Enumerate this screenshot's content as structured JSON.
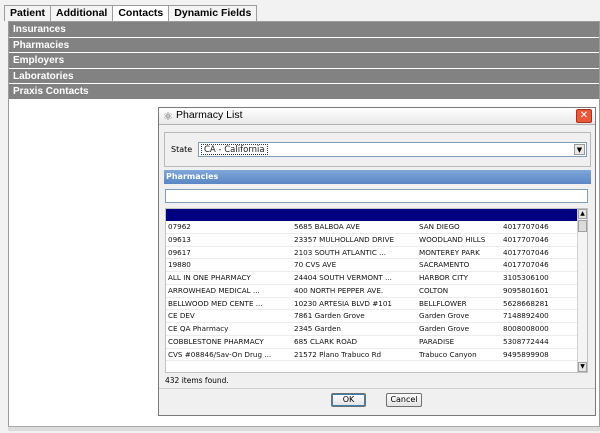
{
  "tabs": [
    {
      "label": "Patient",
      "active": false
    },
    {
      "label": "Additional",
      "active": false
    },
    {
      "label": "Contacts",
      "active": true
    },
    {
      "label": "Dynamic Fields",
      "active": false
    }
  ],
  "sections": [
    "Insurances",
    "Pharmacies",
    "Employers",
    "Laboratories",
    "Praxis Contacts"
  ],
  "dialog": {
    "title": "Pharmacy List",
    "icons": {
      "title": "pharmacy-icon",
      "close": "close-icon"
    },
    "state_label": "State",
    "state_value": "CA - California",
    "list_header": "Pharmacies",
    "filter_value": "",
    "rows": [
      [
        "07962",
        "5685 BALBOA AVE",
        "SAN DIEGO",
        "4017707046"
      ],
      [
        "09613",
        "23357 MULHOLLAND DRIVE",
        "WOODLAND HILLS",
        "4017707046"
      ],
      [
        "09617",
        "2103 SOUTH ATLANTIC ...",
        "MONTEREY PARK",
        "4017707046"
      ],
      [
        "19880",
        "70 CVS AVE",
        "SACRAMENTO",
        "4017707046"
      ],
      [
        "ALL IN ONE PHARMACY",
        "24404 SOUTH VERMONT ...",
        "HARBOR CITY",
        "3105306100"
      ],
      [
        "ARROWHEAD MEDICAL ...",
        "400 NORTH PEPPER AVE.",
        "COLTON",
        "9095801601"
      ],
      [
        "BELLWOOD MED CENTE ...",
        "10230 ARTESIA BLVD #101",
        "BELLFLOWER",
        "5628668281"
      ],
      [
        "CE DEV",
        "7861 Garden Grove",
        "Garden Grove",
        "7148892400"
      ],
      [
        "CE QA Pharmacy",
        "2345 Garden",
        "Garden Grove",
        "8008008000"
      ],
      [
        "COBBLESTONE PHARMACY",
        "685 CLARK ROAD",
        "PARADISE",
        "5308772444"
      ],
      [
        "CVS #08846/Sav-On Drug ...",
        "21572 Plano Trabuco Rd",
        "Trabuco Canyon",
        "9495899908"
      ]
    ],
    "count_text": "432 items found.",
    "ok_label": "OK",
    "cancel_label": "Cancel",
    "accent": "#000080"
  }
}
